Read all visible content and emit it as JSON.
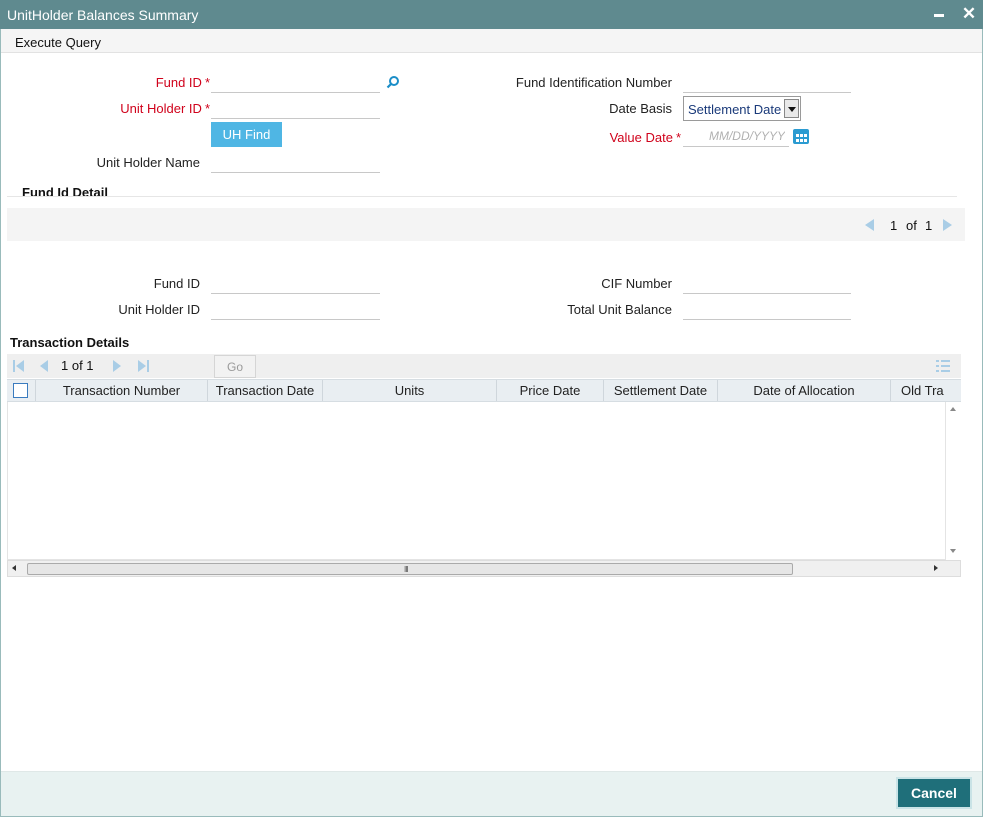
{
  "window": {
    "title": "UnitHolder Balances Summary",
    "close_glyph": "✕"
  },
  "menu": {
    "execute_query": "Execute Query"
  },
  "query_form": {
    "fund_id_label": "Fund ID",
    "unit_holder_id_label": "Unit Holder ID",
    "uh_find_label": "UH Find",
    "unit_holder_name_label": "Unit Holder Name",
    "fund_identification_number_label": "Fund Identification Number",
    "date_basis_label": "Date Basis",
    "date_basis_value": "Settlement Date",
    "value_date_label": "Value Date",
    "value_date_placeholder": "MM/DD/YYYY",
    "required_marker": "*"
  },
  "fund_id_detail": {
    "title": "Fund Id Detail",
    "pager": {
      "current": "1",
      "of": "of",
      "total": "1"
    },
    "fund_id_label": "Fund ID",
    "unit_holder_id_label": "Unit Holder ID",
    "cif_number_label": "CIF Number",
    "total_unit_balance_label": "Total Unit Balance"
  },
  "transaction_details": {
    "title": "Transaction Details",
    "pager": {
      "text": "1 of 1",
      "go_label": "Go"
    },
    "columns": [
      "Transaction Number",
      "Transaction Date",
      "Units",
      "Price Date",
      "Settlement Date",
      "Date of Allocation",
      "Old Tra"
    ],
    "rows": [],
    "scroll_grip": "III"
  },
  "footer": {
    "cancel_label": "Cancel"
  },
  "colors": {
    "titlebar": "#5f8a8f",
    "required": "#d0021b",
    "accent": "#4fb6e4",
    "cancel": "#1f6f7a"
  }
}
